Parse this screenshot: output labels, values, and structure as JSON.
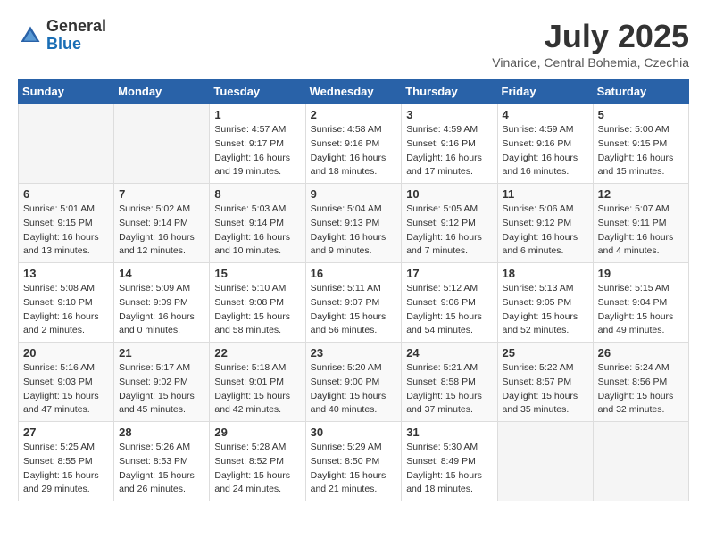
{
  "header": {
    "logo_general": "General",
    "logo_blue": "Blue",
    "title": "July 2025",
    "location": "Vinarice, Central Bohemia, Czechia"
  },
  "calendar": {
    "days_of_week": [
      "Sunday",
      "Monday",
      "Tuesday",
      "Wednesday",
      "Thursday",
      "Friday",
      "Saturday"
    ],
    "weeks": [
      [
        {
          "day": "",
          "sunrise": "",
          "sunset": "",
          "daylight": ""
        },
        {
          "day": "",
          "sunrise": "",
          "sunset": "",
          "daylight": ""
        },
        {
          "day": "1",
          "sunrise": "Sunrise: 4:57 AM",
          "sunset": "Sunset: 9:17 PM",
          "daylight": "Daylight: 16 hours and 19 minutes."
        },
        {
          "day": "2",
          "sunrise": "Sunrise: 4:58 AM",
          "sunset": "Sunset: 9:16 PM",
          "daylight": "Daylight: 16 hours and 18 minutes."
        },
        {
          "day": "3",
          "sunrise": "Sunrise: 4:59 AM",
          "sunset": "Sunset: 9:16 PM",
          "daylight": "Daylight: 16 hours and 17 minutes."
        },
        {
          "day": "4",
          "sunrise": "Sunrise: 4:59 AM",
          "sunset": "Sunset: 9:16 PM",
          "daylight": "Daylight: 16 hours and 16 minutes."
        },
        {
          "day": "5",
          "sunrise": "Sunrise: 5:00 AM",
          "sunset": "Sunset: 9:15 PM",
          "daylight": "Daylight: 16 hours and 15 minutes."
        }
      ],
      [
        {
          "day": "6",
          "sunrise": "Sunrise: 5:01 AM",
          "sunset": "Sunset: 9:15 PM",
          "daylight": "Daylight: 16 hours and 13 minutes."
        },
        {
          "day": "7",
          "sunrise": "Sunrise: 5:02 AM",
          "sunset": "Sunset: 9:14 PM",
          "daylight": "Daylight: 16 hours and 12 minutes."
        },
        {
          "day": "8",
          "sunrise": "Sunrise: 5:03 AM",
          "sunset": "Sunset: 9:14 PM",
          "daylight": "Daylight: 16 hours and 10 minutes."
        },
        {
          "day": "9",
          "sunrise": "Sunrise: 5:04 AM",
          "sunset": "Sunset: 9:13 PM",
          "daylight": "Daylight: 16 hours and 9 minutes."
        },
        {
          "day": "10",
          "sunrise": "Sunrise: 5:05 AM",
          "sunset": "Sunset: 9:12 PM",
          "daylight": "Daylight: 16 hours and 7 minutes."
        },
        {
          "day": "11",
          "sunrise": "Sunrise: 5:06 AM",
          "sunset": "Sunset: 9:12 PM",
          "daylight": "Daylight: 16 hours and 6 minutes."
        },
        {
          "day": "12",
          "sunrise": "Sunrise: 5:07 AM",
          "sunset": "Sunset: 9:11 PM",
          "daylight": "Daylight: 16 hours and 4 minutes."
        }
      ],
      [
        {
          "day": "13",
          "sunrise": "Sunrise: 5:08 AM",
          "sunset": "Sunset: 9:10 PM",
          "daylight": "Daylight: 16 hours and 2 minutes."
        },
        {
          "day": "14",
          "sunrise": "Sunrise: 5:09 AM",
          "sunset": "Sunset: 9:09 PM",
          "daylight": "Daylight: 16 hours and 0 minutes."
        },
        {
          "day": "15",
          "sunrise": "Sunrise: 5:10 AM",
          "sunset": "Sunset: 9:08 PM",
          "daylight": "Daylight: 15 hours and 58 minutes."
        },
        {
          "day": "16",
          "sunrise": "Sunrise: 5:11 AM",
          "sunset": "Sunset: 9:07 PM",
          "daylight": "Daylight: 15 hours and 56 minutes."
        },
        {
          "day": "17",
          "sunrise": "Sunrise: 5:12 AM",
          "sunset": "Sunset: 9:06 PM",
          "daylight": "Daylight: 15 hours and 54 minutes."
        },
        {
          "day": "18",
          "sunrise": "Sunrise: 5:13 AM",
          "sunset": "Sunset: 9:05 PM",
          "daylight": "Daylight: 15 hours and 52 minutes."
        },
        {
          "day": "19",
          "sunrise": "Sunrise: 5:15 AM",
          "sunset": "Sunset: 9:04 PM",
          "daylight": "Daylight: 15 hours and 49 minutes."
        }
      ],
      [
        {
          "day": "20",
          "sunrise": "Sunrise: 5:16 AM",
          "sunset": "Sunset: 9:03 PM",
          "daylight": "Daylight: 15 hours and 47 minutes."
        },
        {
          "day": "21",
          "sunrise": "Sunrise: 5:17 AM",
          "sunset": "Sunset: 9:02 PM",
          "daylight": "Daylight: 15 hours and 45 minutes."
        },
        {
          "day": "22",
          "sunrise": "Sunrise: 5:18 AM",
          "sunset": "Sunset: 9:01 PM",
          "daylight": "Daylight: 15 hours and 42 minutes."
        },
        {
          "day": "23",
          "sunrise": "Sunrise: 5:20 AM",
          "sunset": "Sunset: 9:00 PM",
          "daylight": "Daylight: 15 hours and 40 minutes."
        },
        {
          "day": "24",
          "sunrise": "Sunrise: 5:21 AM",
          "sunset": "Sunset: 8:58 PM",
          "daylight": "Daylight: 15 hours and 37 minutes."
        },
        {
          "day": "25",
          "sunrise": "Sunrise: 5:22 AM",
          "sunset": "Sunset: 8:57 PM",
          "daylight": "Daylight: 15 hours and 35 minutes."
        },
        {
          "day": "26",
          "sunrise": "Sunrise: 5:24 AM",
          "sunset": "Sunset: 8:56 PM",
          "daylight": "Daylight: 15 hours and 32 minutes."
        }
      ],
      [
        {
          "day": "27",
          "sunrise": "Sunrise: 5:25 AM",
          "sunset": "Sunset: 8:55 PM",
          "daylight": "Daylight: 15 hours and 29 minutes."
        },
        {
          "day": "28",
          "sunrise": "Sunrise: 5:26 AM",
          "sunset": "Sunset: 8:53 PM",
          "daylight": "Daylight: 15 hours and 26 minutes."
        },
        {
          "day": "29",
          "sunrise": "Sunrise: 5:28 AM",
          "sunset": "Sunset: 8:52 PM",
          "daylight": "Daylight: 15 hours and 24 minutes."
        },
        {
          "day": "30",
          "sunrise": "Sunrise: 5:29 AM",
          "sunset": "Sunset: 8:50 PM",
          "daylight": "Daylight: 15 hours and 21 minutes."
        },
        {
          "day": "31",
          "sunrise": "Sunrise: 5:30 AM",
          "sunset": "Sunset: 8:49 PM",
          "daylight": "Daylight: 15 hours and 18 minutes."
        },
        {
          "day": "",
          "sunrise": "",
          "sunset": "",
          "daylight": ""
        },
        {
          "day": "",
          "sunrise": "",
          "sunset": "",
          "daylight": ""
        }
      ]
    ]
  }
}
